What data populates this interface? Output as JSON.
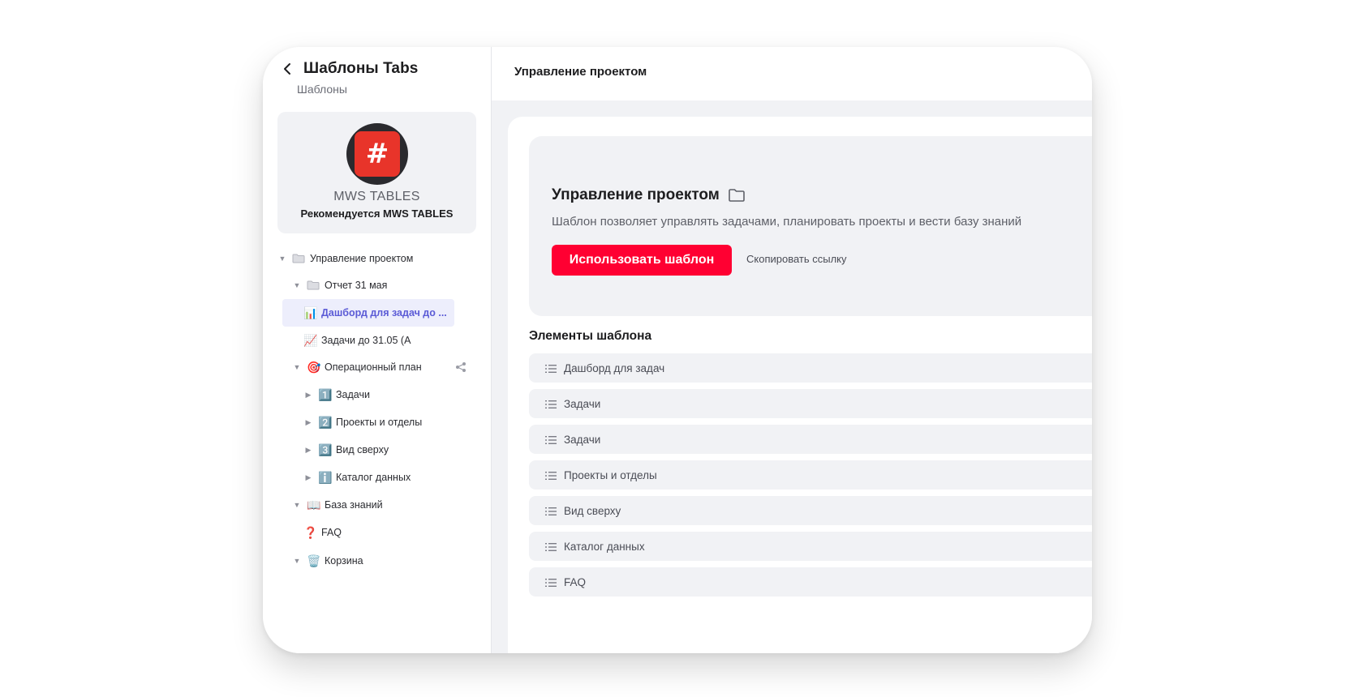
{
  "sidebar": {
    "title": "Шаблоны Tabs",
    "subtitle": "Шаблоны",
    "card": {
      "logo_glyph": "#",
      "name": "MWS TABLES",
      "recommended": "Рекомендуется MWS TABLES"
    },
    "tree": [
      {
        "label": "Управление проектом",
        "icon": "folder-icon",
        "caret": "▼"
      },
      {
        "label": "Отчет 31 мая",
        "icon": "folder-icon",
        "caret": "▼"
      },
      {
        "label": "Дашборд для задач до ...",
        "icon": "📊",
        "caret": ""
      },
      {
        "label": "Задачи до 31.05 (А",
        "icon": "📈",
        "caret": ""
      },
      {
        "label": "Операционный план",
        "icon": "🎯",
        "caret": "▼"
      },
      {
        "label": "Задачи",
        "icon": "1️⃣",
        "caret": "▶"
      },
      {
        "label": "Проекты и отделы",
        "icon": "2️⃣",
        "caret": "▶"
      },
      {
        "label": "Вид сверху",
        "icon": "3️⃣",
        "caret": "▶"
      },
      {
        "label": "Каталог данных",
        "icon": "ℹ️",
        "caret": "▶"
      },
      {
        "label": "База знаний",
        "icon": "📖",
        "caret": "▼"
      },
      {
        "label": "FAQ",
        "icon": "❓",
        "caret": ""
      },
      {
        "label": "Корзина",
        "icon": "🗑️",
        "caret": "▼"
      }
    ]
  },
  "main": {
    "header_title": "Управление проектом",
    "hero": {
      "title": "Управление проектом",
      "description": "Шаблон позволяет управлять задачами, планировать проекты и вести базу знаний",
      "use_button": "Использовать шаблон",
      "copy_link": "Скопировать ссылку"
    },
    "elements_title": "Элементы шаблона",
    "elements": [
      "Дашборд для задач",
      "Задачи",
      "Задачи",
      "Проекты и отделы",
      "Вид сверху",
      "Каталог данных",
      "FAQ"
    ]
  },
  "colors": {
    "accent": "#ff0032",
    "active_item": "#5b5bd6",
    "panel_bg": "#f1f2f5"
  }
}
